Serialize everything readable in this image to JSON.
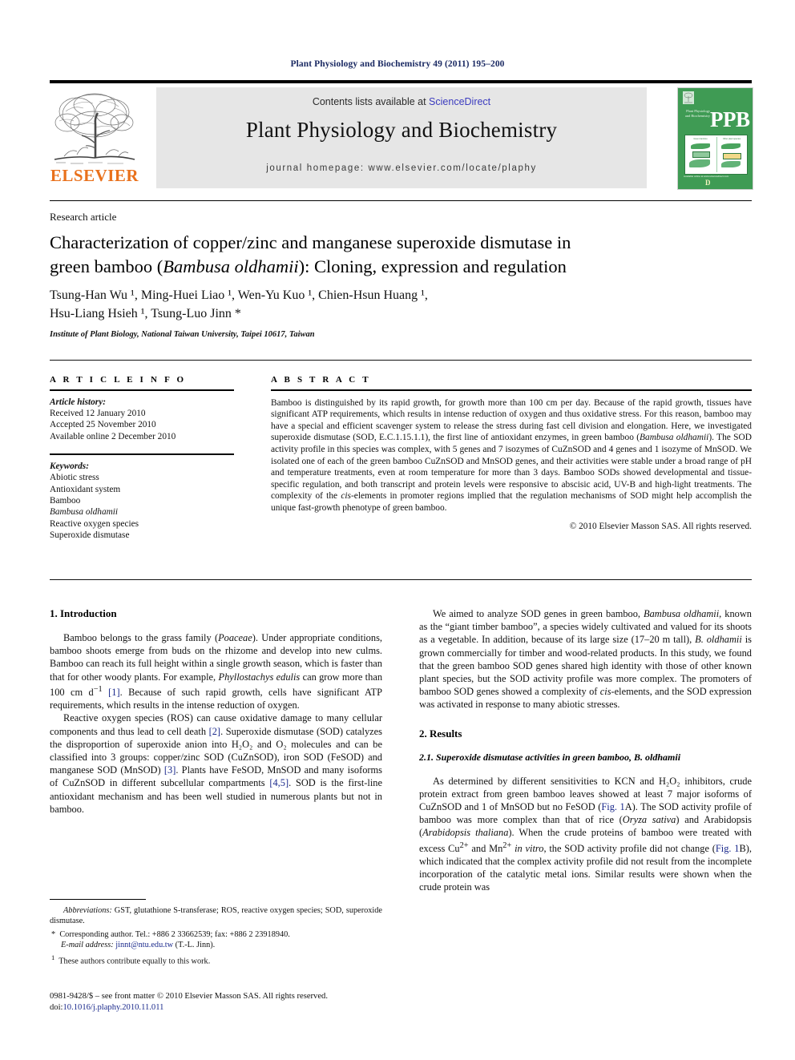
{
  "running_head": "Plant Physiology and Biochemistry 49 (2011) 195–200",
  "masthead": {
    "publisher_name": "ELSEVIER",
    "contents_prefix": "Contents lists available at ",
    "contents_link": "ScienceDirect",
    "journal_title": "Plant Physiology and Biochemistry",
    "journal_homepage": "journal homepage: www.elsevier.com/locate/plaphy",
    "cover": {
      "abbrev": "PPB",
      "journal_name_lines": "Plant Physiology and Biochemistry",
      "art_panel_left_caption": "Green bamboo",
      "art_panel_right_caption": "Other plant species",
      "footer_text": "Available online at\nwww.sciencedirect.com",
      "footer_mark": "D"
    },
    "cover_color": "#3f9b54",
    "link_color": "#3b3bbf",
    "accent_color": "#E9711C"
  },
  "article_type": "Research article",
  "title": {
    "line1_a": "Characterization of copper/zinc and manganese superoxide dismutase in",
    "line2_a": "green bamboo (",
    "line2_italic": "Bambusa oldhamii",
    "line2_b": "): Cloning, expression and regulation"
  },
  "authors": {
    "line1": "Tsung-Han Wu ¹, Ming-Huei Liao ¹, Wen-Yu Kuo ¹, Chien-Hsun Huang ¹,",
    "line2": "Hsu-Liang Hsieh ¹, Tsung-Luo Jinn *",
    "names": [
      {
        "name": "Tsung-Han Wu",
        "mark": "1"
      },
      {
        "name": "Ming-Huei Liao",
        "mark": "1"
      },
      {
        "name": "Wen-Yu Kuo",
        "mark": "1"
      },
      {
        "name": "Chien-Hsun Huang",
        "mark": "1"
      },
      {
        "name": "Hsu-Liang Hsieh",
        "mark": "1"
      },
      {
        "name": "Tsung-Luo Jinn",
        "mark": "*"
      }
    ],
    "affiliation": "Institute of Plant Biology, National Taiwan University, Taipei 10617, Taiwan"
  },
  "info": {
    "heading": "A R T I C L E   I N F O",
    "history_label": "Article history:",
    "history": [
      "Received 12 January 2010",
      "Accepted 25 November 2010",
      "Available online 2 December 2010"
    ],
    "keywords_label": "Keywords:",
    "keywords": [
      "Abiotic stress",
      "Antioxidant system",
      "Bamboo",
      "Bambusa oldhamii",
      "Reactive oxygen species",
      "Superoxide dismutase"
    ],
    "keyword_italic_index": 3
  },
  "abstract": {
    "heading": "A B S T R A C T",
    "p1": "Bamboo is distinguished by its rapid growth, for growth more than 100 cm per day. Because of the rapid growth, tissues have significant ATP requirements, which results in intense reduction of oxygen and thus oxidative stress. For this reason, bamboo may have a special and efficient scavenger system to release the stress during fast cell division and elongation. Here, we investigated superoxide dismutase (SOD, E.C.1.15.1.1), the first line of antioxidant enzymes, in green bamboo (",
    "p1_italic": "Bambusa oldhamii",
    "p1_b": "). The SOD activity profile in this species was complex, with 5 genes and 7 isozymes of CuZnSOD and 4 genes and 1 isozyme of MnSOD. We isolated one of each of the green bamboo CuZnSOD and MnSOD genes, and their activities were stable under a broad range of pH and temperature treatments, even at room temperature for more than 3 days. Bamboo SODs showed developmental and tissue-specific regulation, and both transcript and protein levels were responsive to abscisic acid, UV-B and high-light treatments. The complexity of the ",
    "p1_italic2": "cis",
    "p1_c": "-elements in promoter regions implied that the regulation mechanisms of SOD might help accomplish the unique fast-growth phenotype of green bamboo.",
    "copyright": "© 2010 Elsevier Masson SAS. All rights reserved."
  },
  "sections": {
    "intro_heading": "1.  Introduction",
    "intro_p1_a": "Bamboo belongs to the grass family (",
    "intro_p1_i1": "Poaceae",
    "intro_p1_b": "). Under appropriate conditions, bamboo shoots emerge from buds on the rhizome and develop into new culms. Bamboo can reach its full height within a single growth season, which is faster than that for other woody plants. For example, ",
    "intro_p1_i2": "Phyllostachys edulis",
    "intro_p1_c": " can grow more than 100 cm d",
    "intro_p1_sup": "−1",
    "intro_p1_cite1": "[1]",
    "intro_p1_d": ". Because of such rapid growth, cells have significant ATP requirements, which results in the intense reduction of oxygen.",
    "intro_p2_a": "Reactive oxygen species (ROS) can cause oxidative damage to many cellular components and thus lead to cell death ",
    "intro_p2_cite1": "[2]",
    "intro_p2_b": ". Superoxide dismutase (SOD) catalyzes the disproportion of superoxide anion into H₂O₂ and O₂ molecules and can be classified into 3 groups: copper/zinc SOD (CuZnSOD), iron SOD (FeSOD) and manganese SOD (MnSOD) ",
    "intro_p2_cite2": "[3]",
    "intro_p2_c": ". Plants have FeSOD, MnSOD and many isoforms of CuZnSOD in different subcellular compartments ",
    "intro_p2_cite3": "[4,5]",
    "intro_p2_d": ". SOD is the first-line antioxidant mechanism and has been well studied in numerous plants but not in bamboo.",
    "aim_p_a": "We aimed to analyze SOD genes in green bamboo, ",
    "aim_p_i1": "Bambusa oldhamii",
    "aim_p_b": ", known as the “giant timber bamboo”, a species widely cultivated and valued for its shoots as a vegetable. In addition, because of its large size (17–20 m tall), ",
    "aim_p_i2": "B. oldhamii",
    "aim_p_c": " is grown commercially for timber and wood-related products. In this study, we found that the green bamboo SOD genes shared high identity with those of other known plant species, but the SOD activity profile was more complex. The promoters of bamboo SOD genes showed a complexity of ",
    "aim_p_i3": "cis",
    "aim_p_d": "-elements, and the SOD expression was activated in response to many abiotic stresses.",
    "results_heading": "2.  Results",
    "results_sub_heading_a": "2.1.  Superoxide dismutase activities in green bamboo, ",
    "results_sub_heading_i": "B. oldhamii",
    "results_p1_a": "As determined by different sensitivities to KCN and H₂O₂ inhibitors, crude protein extract from green bamboo leaves showed at least 7 major isoforms of CuZnSOD and 1 of MnSOD but no FeSOD (",
    "results_p1_ref1": "Fig. 1",
    "results_p1_b": "A). The SOD activity profile of bamboo was more complex than that of rice (",
    "results_p1_i1": "Oryza sativa",
    "results_p1_c": ") and Arabidopsis (",
    "results_p1_i2": "Arabidopsis thaliana",
    "results_p1_d": "). When the crude proteins of bamboo were treated with excess Cu",
    "results_p1_sup1": "2+",
    "results_p1_e": " and Mn",
    "results_p1_sup2": "2+",
    "results_p1_f": " ",
    "results_p1_i3": "in vitro",
    "results_p1_g": ", the SOD activity profile did not change (",
    "results_p1_ref2": "Fig. 1",
    "results_p1_h": "B), which indicated that the complex activity profile did not result from the incomplete incorporation of the catalytic metal ions. Similar results were shown when the crude protein was"
  },
  "footnotes": {
    "abbrev_label": "Abbreviations:",
    "abbrev_text": " GST, glutathione S-transferase; ROS, reactive oxygen species; SOD, superoxide dismutase.",
    "corresponding_mark": "*",
    "corresponding_text": "Corresponding author. Tel.: +886 2 33662539; fax: +886 2 23918940.",
    "email_label": "E-mail address:",
    "email": "jinnt@ntu.edu.tw",
    "email_suffix": " (T.-L. Jinn).",
    "equal_mark": "1",
    "equal_text": "These authors contribute equally to this work."
  },
  "imprint": {
    "line1": "0981-9428/$ – see front matter © 2010 Elsevier Masson SAS. All rights reserved.",
    "doi_label": "doi:",
    "doi": "10.1016/j.plaphy.2010.11.011"
  }
}
